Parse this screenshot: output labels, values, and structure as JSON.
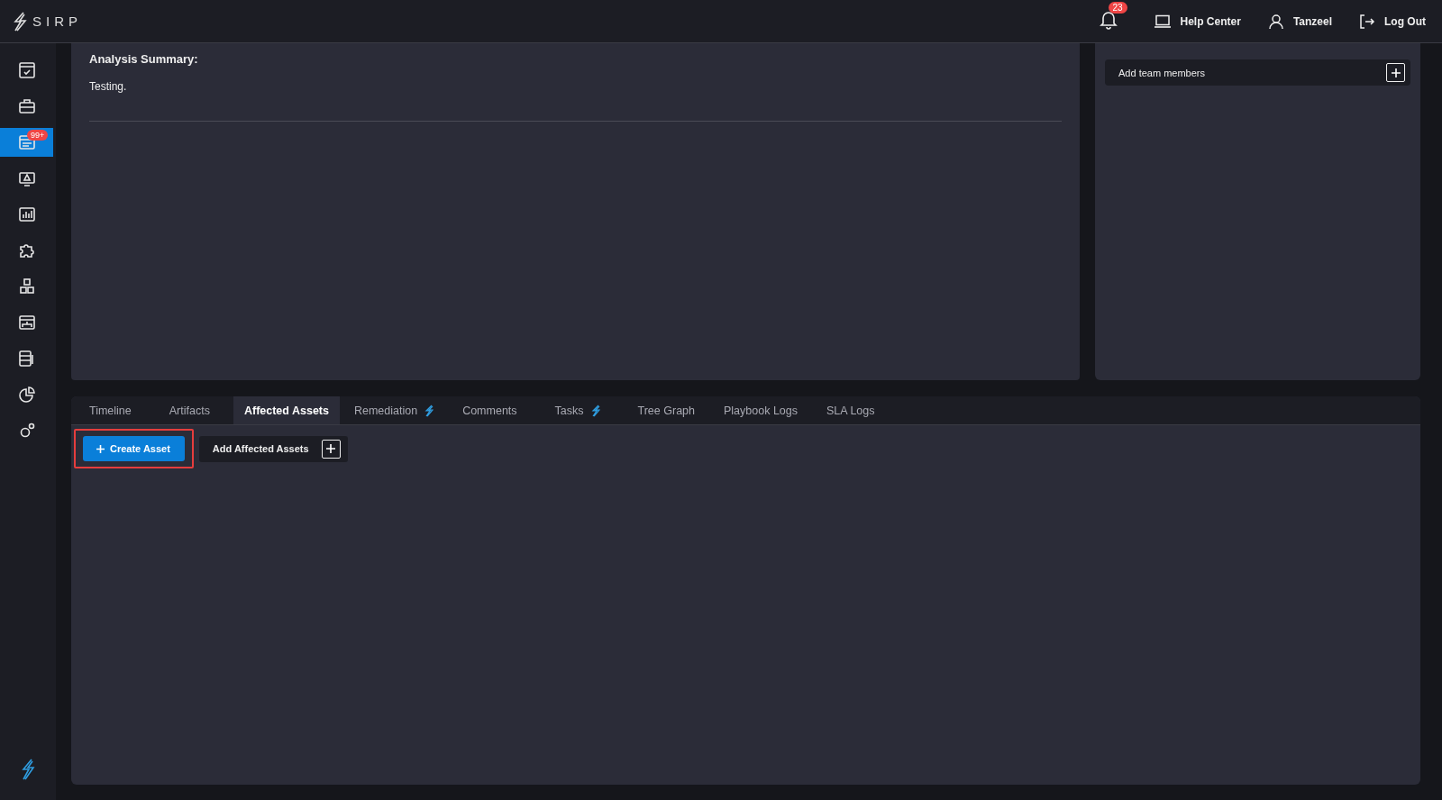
{
  "header": {
    "logo": "SIRP",
    "notifications": "23",
    "help": "Help Center",
    "user": "Tanzeel",
    "logout": "Log Out"
  },
  "sidebar": {
    "items": [
      {
        "selected": false
      },
      {
        "selected": false
      },
      {
        "selected": true,
        "badge": "99+"
      },
      {
        "selected": false
      },
      {
        "selected": false
      },
      {
        "selected": false
      },
      {
        "selected": false
      },
      {
        "selected": false
      },
      {
        "selected": false
      },
      {
        "selected": false
      },
      {
        "selected": false
      }
    ]
  },
  "summary": {
    "heading": "Analysis Summary:",
    "text": "Testing."
  },
  "team": {
    "label": "Add team members"
  },
  "tabs": [
    {
      "label": "Timeline",
      "selected": false,
      "bolt": false
    },
    {
      "label": "Artifacts",
      "selected": false,
      "bolt": false
    },
    {
      "label": "Affected Assets",
      "selected": true,
      "bolt": false
    },
    {
      "label": "Remediation",
      "selected": false,
      "bolt": true
    },
    {
      "label": "Comments",
      "selected": false,
      "bolt": false
    },
    {
      "label": "Tasks",
      "selected": false,
      "bolt": true
    },
    {
      "label": "Tree Graph",
      "selected": false,
      "bolt": false
    },
    {
      "label": "Playbook Logs",
      "selected": false,
      "bolt": false
    },
    {
      "label": "SLA Logs",
      "selected": false,
      "bolt": false
    }
  ],
  "actions": {
    "create": {
      "label": "Create Asset",
      "highlighted": true
    },
    "add": {
      "label": "Add Affected Assets"
    }
  }
}
